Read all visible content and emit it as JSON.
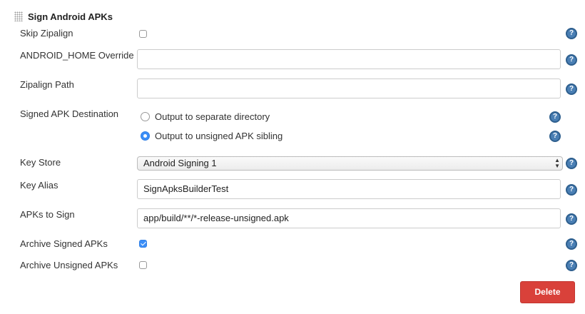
{
  "section": {
    "title": "Sign Android APKs"
  },
  "fields": {
    "skip_zipalign": {
      "label": "Skip Zipalign",
      "checked": false
    },
    "android_home": {
      "label": "ANDROID_HOME Override",
      "value": ""
    },
    "zipalign_path": {
      "label": "Zipalign Path",
      "value": ""
    },
    "signed_apk_destination": {
      "label": "Signed APK Destination",
      "options": [
        "Output to separate directory",
        "Output to unsigned APK sibling"
      ],
      "selected": "Output to unsigned APK sibling"
    },
    "key_store": {
      "label": "Key Store",
      "value": "Android Signing 1"
    },
    "key_alias": {
      "label": "Key Alias",
      "value": "SignApksBuilderTest"
    },
    "apks_to_sign": {
      "label": "APKs to Sign",
      "value": "app/build/**/*-release-unsigned.apk"
    },
    "archive_signed": {
      "label": "Archive Signed APKs",
      "checked": true
    },
    "archive_unsigned": {
      "label": "Archive Unsigned APKs",
      "checked": false
    }
  },
  "help_glyph": "?",
  "actions": {
    "delete_label": "Delete"
  },
  "colors": {
    "accent": "#3b8ef7",
    "help": "#4a7fb4",
    "delete": "#d9413a"
  },
  "icons": {
    "drag": "drag-handle-icon",
    "help": "help-icon"
  }
}
